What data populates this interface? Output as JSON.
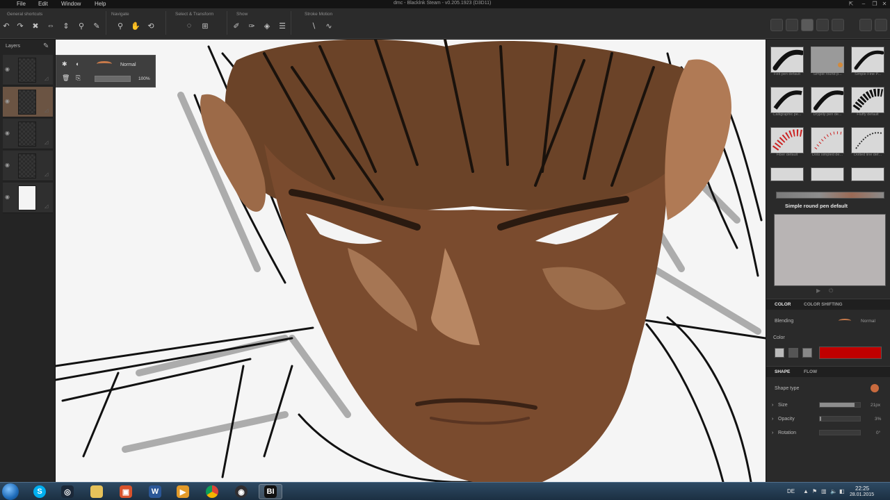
{
  "menu": {
    "items": [
      "File",
      "Edit",
      "Window",
      "Help"
    ]
  },
  "window": {
    "title": "dmc - Blacklnk Steam - v0.205.1923 (D3D11)"
  },
  "toolbar": {
    "groups": [
      "General shortcuts",
      "Navigate",
      "Select & Transform",
      "Show",
      "Stroke Motion"
    ]
  },
  "layers": {
    "title": "Layers",
    "popup": {
      "blend_mode": "Normal",
      "opacity": "100%"
    }
  },
  "presets": {
    "labels": [
      "Felt pen default",
      "Simple round p...",
      "Simple Fine P...",
      "Calligraphic pe...",
      "Dryjelly pen de...",
      "Fluffy default",
      "Fiber default",
      "Dots simpled de...",
      "Dotted line def..."
    ]
  },
  "brush": {
    "name": "Simple round pen default"
  },
  "color_section": {
    "tabs": [
      "COLOR",
      "COLOR SHIFTING"
    ],
    "blending_label": "Blending",
    "blending_value": "Normal",
    "color_label": "Color",
    "color_hex": "#c00000"
  },
  "shape_section": {
    "tabs": [
      "SHAPE",
      "FLOW"
    ],
    "shape_type_label": "Shape type",
    "size_label": "Size",
    "size_value": "21px",
    "opacity_label": "Opacity",
    "opacity_value": "3%",
    "rotation_label": "Rotation",
    "rotation_value": "0°"
  },
  "taskbar": {
    "lang": "DE",
    "time": "22:25",
    "date": "28.01.2015"
  }
}
